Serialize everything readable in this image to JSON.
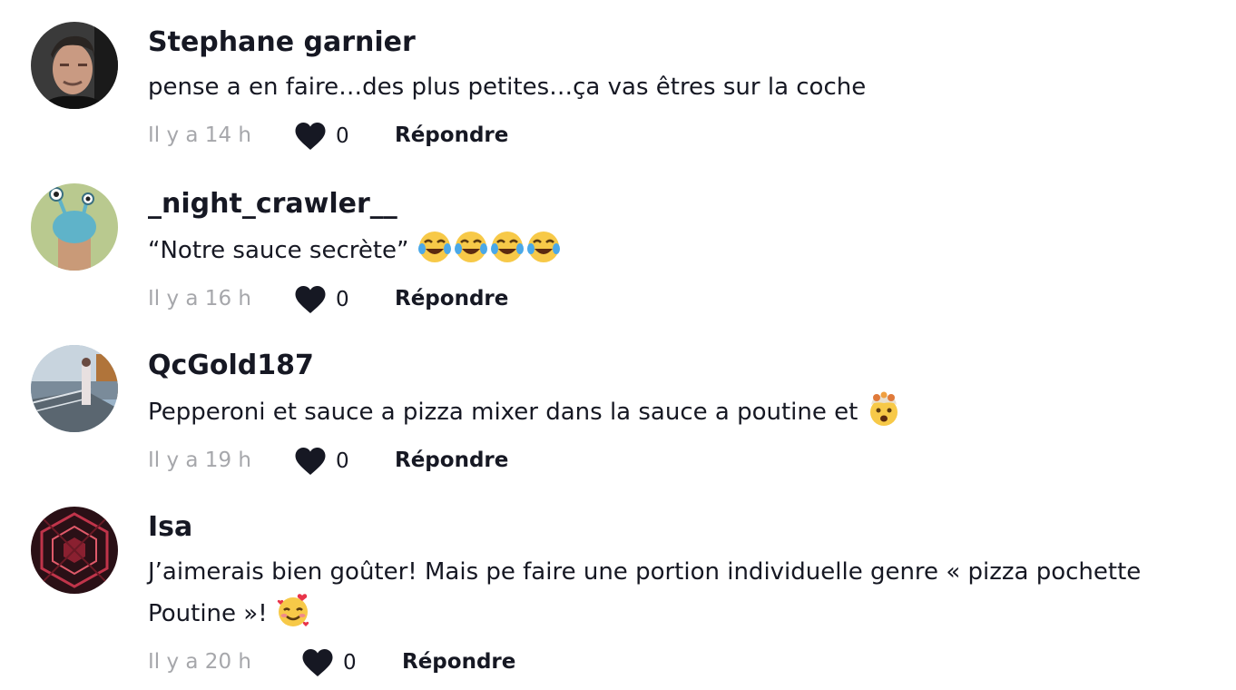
{
  "comments": [
    {
      "username": "Stephane garnier",
      "text": "pense a en faire…des plus petites…ça vas êtres sur la coche",
      "time": "Il y a 14 h",
      "likes": "0",
      "reply_label": "Répondre",
      "avatar": "photo-man-avatar"
    },
    {
      "username": "_night_crawler__",
      "text": "“Notre sauce secrète” ",
      "emojis": [
        "tears-of-joy-emoji",
        "tears-of-joy-emoji",
        "tears-of-joy-emoji",
        "tears-of-joy-emoji"
      ],
      "time": "Il y a 16 h",
      "likes": "0",
      "reply_label": "Répondre",
      "avatar": "cartoon-snail-avatar"
    },
    {
      "username": "QcGold187",
      "text": "Pepperoni et sauce a pizza mixer dans la sauce a poutine et ",
      "emojis": [
        "exploding-head-emoji"
      ],
      "time": "Il y a 19 h",
      "likes": "0",
      "reply_label": "Répondre",
      "avatar": "outdoor-photo-avatar"
    },
    {
      "username": "Isa",
      "text_line1": "J’aimerais bien goûter! Mais pe faire une portion individuelle genre « pizza pochette",
      "text_line2": "Poutine »! ",
      "emojis": [
        "smiling-face-with-hearts-emoji"
      ],
      "time": "Il y a 20 h",
      "likes": "0",
      "reply_label": "Répondre",
      "avatar": "red-pattern-avatar"
    }
  ],
  "colors": {
    "text": "#161823",
    "muted": "#a6a7ab",
    "background": "#ffffff"
  }
}
